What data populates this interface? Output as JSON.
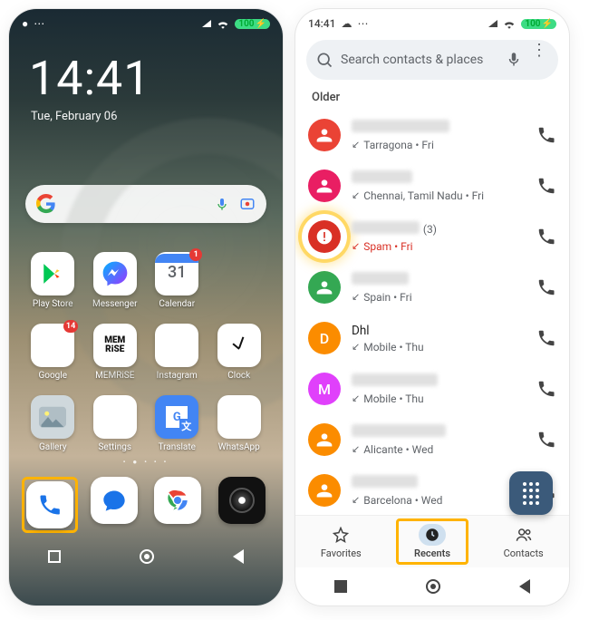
{
  "home": {
    "status_time": "",
    "battery": "100",
    "clock": "14:41",
    "date": "Tue, February 06",
    "apps": {
      "play": "Play Store",
      "messenger": "Messenger",
      "calendar": "Calendar",
      "calendar_day": "31",
      "calendar_badge": "1",
      "google_folder": "Google",
      "google_badge": "14",
      "memrise": "MEMRiSE",
      "instagram": "Instagram",
      "clock_app": "Clock",
      "gallery": "Gallery",
      "settings": "Settings",
      "translate": "Translate",
      "whatsapp": "WhatsApp"
    }
  },
  "phone": {
    "status_time": "14:41",
    "battery": "100",
    "search_placeholder": "Search contacts & places",
    "section": "Older",
    "rows": [
      {
        "sub": "Tarragona • Fri",
        "color": "c-red",
        "dir": "in"
      },
      {
        "sub": "Chennai, Tamil Nadu • Fri",
        "color": "c-pink",
        "dir": "in"
      },
      {
        "sub": "Spam • Fri",
        "color": "c-dred",
        "dir": "missed",
        "spam": true,
        "count": "(3)"
      },
      {
        "sub": "Spain • Fri",
        "color": "c-green",
        "dir": "in"
      },
      {
        "title": "Dhl",
        "sub": "Mobile • Thu",
        "letter": "D",
        "color": "c-orange",
        "dir": "in"
      },
      {
        "sub": "Mobile • Thu",
        "letter": "M",
        "color": "c-mag",
        "dir": "in"
      },
      {
        "sub": "Alicante • Wed",
        "color": "c-orange",
        "dir": "in"
      },
      {
        "sub": "Barcelona • Wed",
        "color": "c-orange",
        "dir": "in"
      }
    ],
    "tabs": {
      "fav": "Favorites",
      "rec": "Recents",
      "con": "Contacts"
    }
  }
}
